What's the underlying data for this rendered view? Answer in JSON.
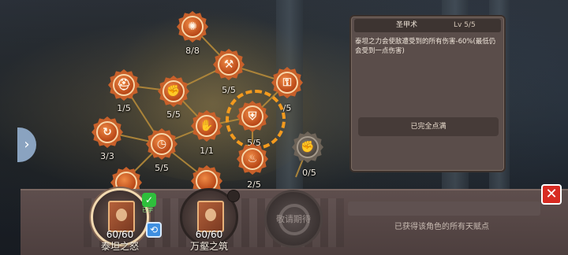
{
  "colors": {
    "node_active": "#c8602a",
    "node_locked": "#6d6358",
    "selection_ring": "#f39a1e",
    "panel_bg": "#5a4d4a",
    "close_button": "#d82b22",
    "learned_badge": "#2fbf3c",
    "reset_badge": "#3f8fe0"
  },
  "tree": {
    "nodes": [
      {
        "id": "top",
        "level": "8/8",
        "icon": "shield-burst-icon",
        "locked": false
      },
      {
        "id": "hammer",
        "level": "5/5",
        "icon": "hammer-icon",
        "locked": false
      },
      {
        "id": "left-upper",
        "level": "1/5",
        "icon": "helmet-icon",
        "locked": false
      },
      {
        "id": "muscle",
        "level": "5/5",
        "icon": "muscle-icon",
        "locked": false
      },
      {
        "id": "right-upper",
        "level": "/5",
        "icon": "key-icon",
        "locked": false
      },
      {
        "id": "refresh",
        "level": "3/3",
        "icon": "refresh-icon",
        "locked": false
      },
      {
        "id": "center",
        "level": "1/1",
        "icon": "fist-icon",
        "locked": false
      },
      {
        "id": "selected",
        "level": "5/5",
        "icon": "holy-armor-icon",
        "locked": false
      },
      {
        "id": "clock",
        "level": "5/5",
        "icon": "clock-icon",
        "locked": false
      },
      {
        "id": "flame",
        "level": "2/5",
        "icon": "flame-icon",
        "locked": false
      },
      {
        "id": "locked",
        "level": "0/5",
        "icon": "fist-icon",
        "locked": true
      }
    ]
  },
  "panel": {
    "name": "圣甲术",
    "level": "Lv 5/5",
    "description": "泰坦之力会使敌遭受到的所有伤害-60%(最低仍会受到一点伤害)",
    "status": "已完全点满"
  },
  "bottom": {
    "books": [
      {
        "count": "60/60",
        "name": "泰坦之怒"
      },
      {
        "count": "60/60",
        "name": "万壑之筑"
      },
      {
        "locked_label": "敬请期待"
      }
    ],
    "learned_badge_text": "已学",
    "points_text": "已获得该角色的所有天赋点"
  }
}
